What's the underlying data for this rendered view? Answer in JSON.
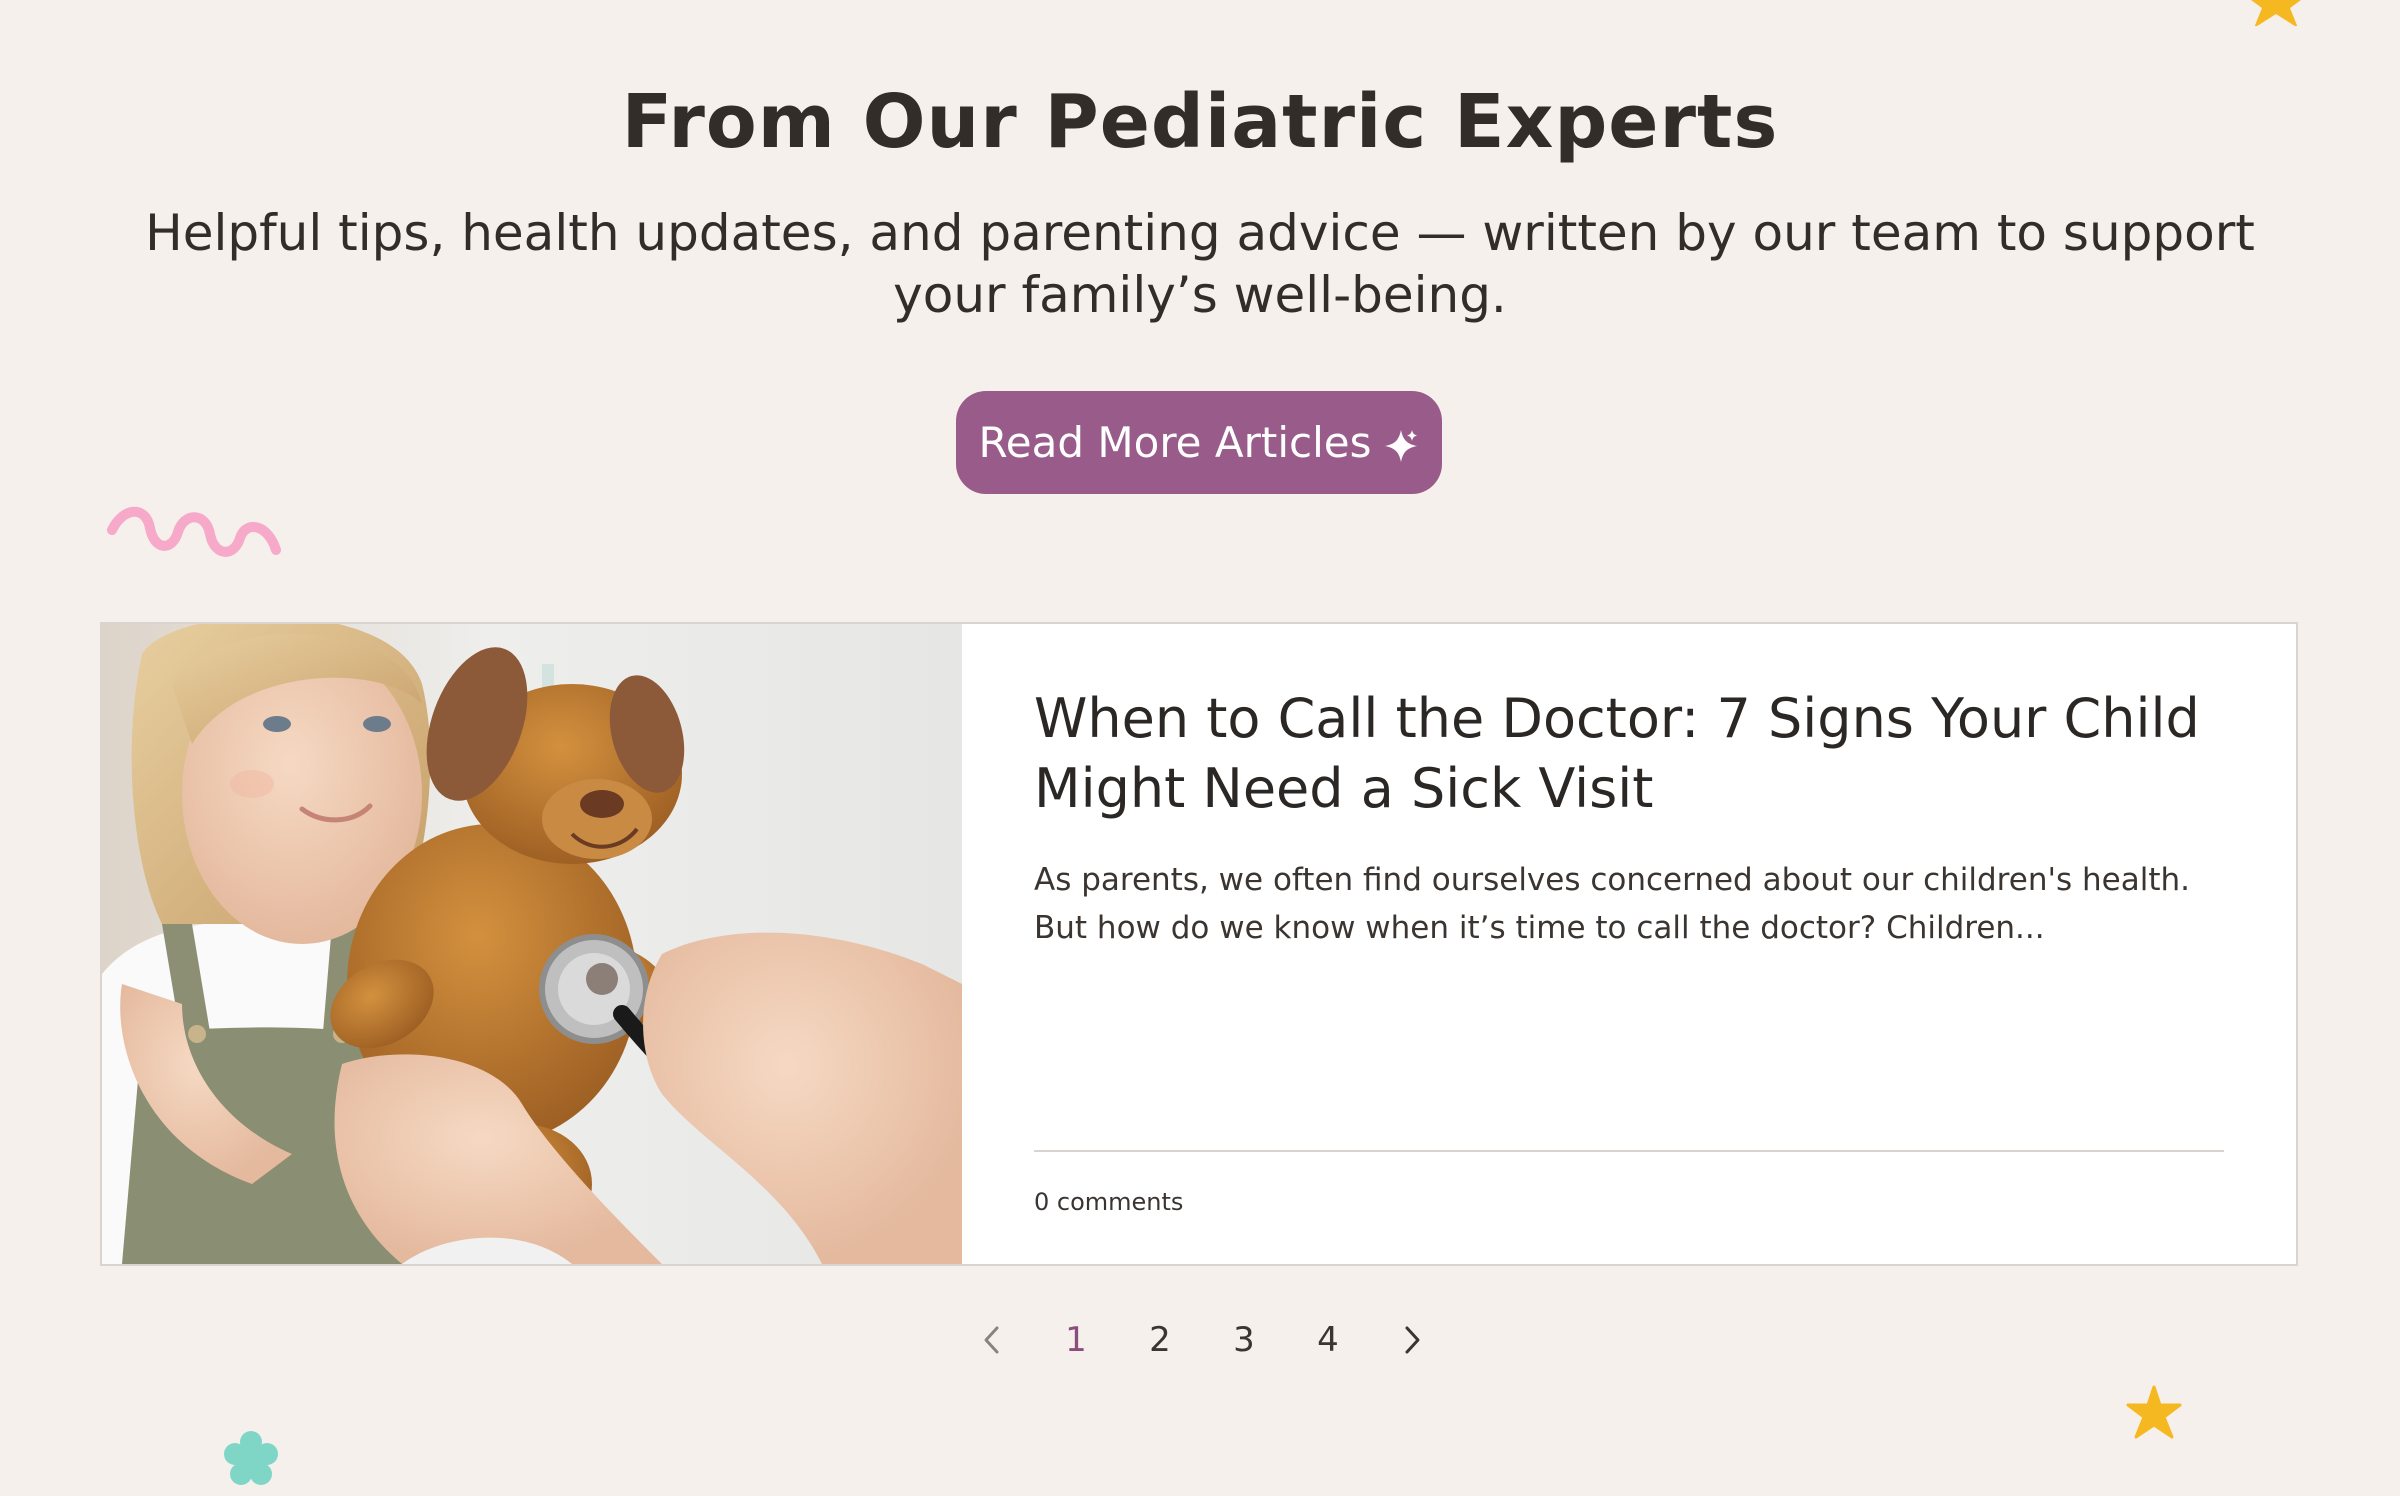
{
  "section": {
    "title": "From Our Pediatric Experts",
    "subtitle": "Helpful tips, health updates, and parenting advice — written by our team to support your family’s well-being.",
    "button_label": "Read More Articles"
  },
  "post": {
    "title": "When to Call the Doctor: 7 Signs Your Child Might Need a Sick Visit",
    "excerpt": "As parents, we often find ourselves concerned about our children's health. But how do we know when it’s time to call the doctor? Children...",
    "comments": "0 comments"
  },
  "pagination": {
    "current_page": 1,
    "pages": [
      "1",
      "2",
      "3",
      "4"
    ],
    "prev_icon": "chevron-left-icon",
    "next_icon": "chevron-right-icon"
  },
  "colors": {
    "background": "#f5f0eb",
    "button": "#995c8a",
    "current_page": "#8a4d7d",
    "decor_yellow": "#f5b820",
    "decor_pink": "#f6a9c8",
    "decor_teal": "#7fd6c7"
  },
  "icons": {
    "button": "sparkle-icon",
    "decorations": [
      "star-icon",
      "squiggle-icon",
      "flower-icon"
    ]
  }
}
